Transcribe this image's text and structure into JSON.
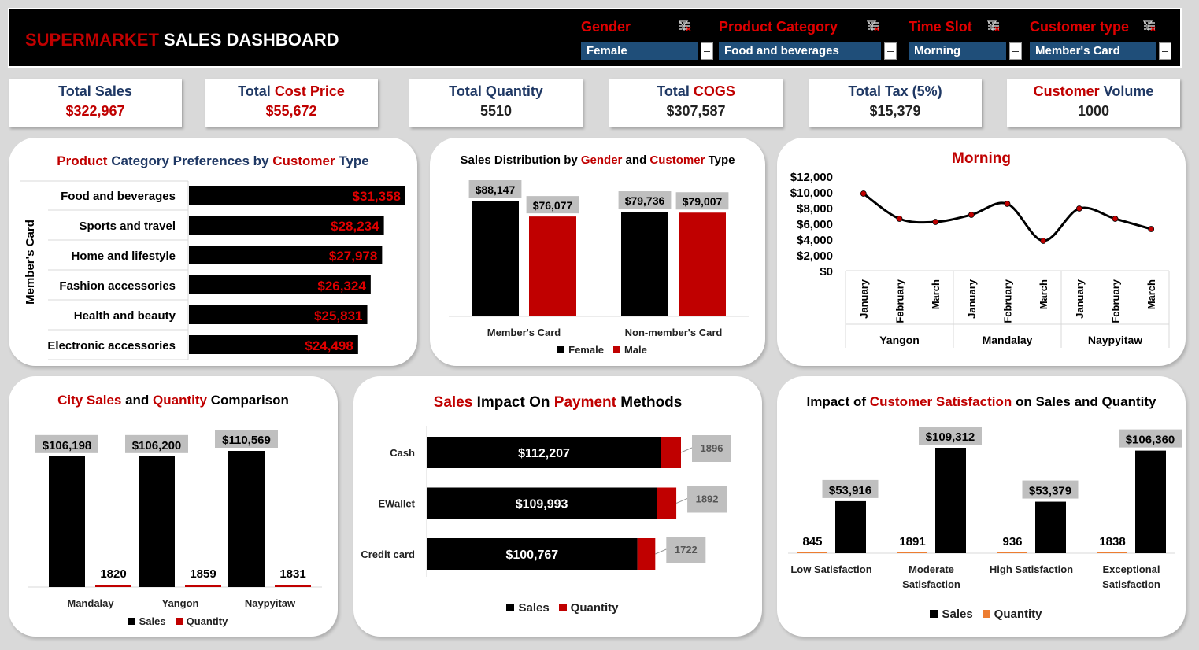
{
  "header": {
    "title_part1": "SUPERMARKET",
    "title_part2": " SALES DASHBOARD",
    "slicers": [
      {
        "title": "Gender",
        "value": "Female"
      },
      {
        "title": "Product Category",
        "value": "Food and beverages"
      },
      {
        "title": "Time Slot",
        "value": "Morning"
      },
      {
        "title": "Customer type",
        "value": "Member's Card"
      }
    ]
  },
  "kpis": {
    "sales": {
      "a": "Total Sales",
      "b": "",
      "value": "$322,967"
    },
    "cost": {
      "a": "Total ",
      "b": "Cost Price",
      "value": "$55,672"
    },
    "qty": {
      "a": "Total Quantity",
      "b": "",
      "value": "5510"
    },
    "cogs": {
      "a": "Total ",
      "b": "COGS",
      "value": "$307,587"
    },
    "tax": {
      "a": "Total Tax (5%)",
      "b": "",
      "value": "$15,379"
    },
    "vol": {
      "a": "Customer",
      "b": " Volume",
      "value": "1000"
    }
  },
  "titles": {
    "p1": [
      "Product",
      " Category Preferences by ",
      "Customer",
      " Type"
    ],
    "p2": [
      "Sales Distribution by ",
      "Gender",
      " and ",
      "Customer",
      " Type"
    ],
    "p4": [
      "City Sales",
      " and ",
      "Quantity",
      " Comparison"
    ],
    "p5": [
      "Sales",
      " Impact On ",
      "Payment",
      " Methods"
    ],
    "p6": [
      "Impact of ",
      "Customer Satisfaction",
      " on Sales and Quantity"
    ]
  },
  "legends": {
    "p2": [
      "Female",
      "Male"
    ],
    "p4": [
      "Sales",
      "Quantity"
    ],
    "p5": [
      "Sales",
      "Quantity"
    ],
    "p6": [
      "Sales",
      "Quantity"
    ]
  },
  "colors": {
    "accent": "#c00000",
    "black": "#000000",
    "gray_label": "#bfbfbf",
    "quantity_orange": "#ed7d31",
    "slicer_blue": "#1f4e79"
  },
  "chart_data": [
    {
      "id": "category-preferences",
      "type": "bar",
      "orientation": "horizontal",
      "group_label": "Member's Card",
      "categories": [
        "Food and beverages",
        "Sports and travel",
        "Home and lifestyle",
        "Fashion accessories",
        "Health and beauty",
        "Electronic accessories"
      ],
      "values": [
        31358,
        28234,
        27978,
        26324,
        25831,
        24498
      ],
      "labels": [
        "$31,358",
        "$28,234",
        "$27,978",
        "$26,324",
        "$25,831",
        "$24,498"
      ]
    },
    {
      "id": "gender-customer",
      "type": "bar",
      "categories": [
        "Member's Card",
        "Non-member's Card"
      ],
      "series": [
        {
          "name": "Female",
          "values": [
            88147,
            79736
          ],
          "labels": [
            "$88,147",
            "$79,736"
          ]
        },
        {
          "name": "Male",
          "values": [
            76077,
            79007
          ],
          "labels": [
            "$76,077",
            "$79,007"
          ]
        }
      ]
    },
    {
      "id": "time-slot-trend",
      "type": "line",
      "title": "Morning",
      "x": [
        "January",
        "February",
        "March",
        "January",
        "February",
        "March",
        "January",
        "February",
        "March"
      ],
      "groups": [
        "Yangon",
        "Mandalay",
        "Naypyitaw"
      ],
      "values": [
        9800,
        6600,
        6200,
        7100,
        8500,
        3800,
        7900,
        6600,
        5300
      ],
      "ylim": [
        0,
        12000
      ],
      "yticks": [
        "$0",
        "$2,000",
        "$4,000",
        "$6,000",
        "$8,000",
        "$10,000",
        "$12,000"
      ]
    },
    {
      "id": "city-comparison",
      "type": "bar",
      "categories": [
        "Mandalay",
        "Yangon",
        "Naypyitaw"
      ],
      "series": [
        {
          "name": "Sales",
          "values": [
            106198,
            106200,
            110569
          ],
          "labels": [
            "$106,198",
            "$106,200",
            "$110,569"
          ]
        },
        {
          "name": "Quantity",
          "values": [
            1820,
            1859,
            1831
          ],
          "labels": [
            "1820",
            "1859",
            "1831"
          ]
        }
      ]
    },
    {
      "id": "payment-methods",
      "type": "bar",
      "orientation": "horizontal",
      "stacked": true,
      "categories": [
        "Cash",
        "EWallet",
        "Credit card"
      ],
      "series": [
        {
          "name": "Sales",
          "values": [
            112207,
            109993,
            100767
          ],
          "labels": [
            "$112,207",
            "$109,993",
            "$100,767"
          ]
        },
        {
          "name": "Quantity",
          "values": [
            1896,
            1892,
            1722
          ],
          "labels": [
            "1896",
            "1892",
            "1722"
          ]
        }
      ]
    },
    {
      "id": "satisfaction-impact",
      "type": "bar",
      "categories": [
        "Low Satisfaction",
        "Moderate Satisfaction",
        "High Satisfaction",
        "Exceptional Satisfaction"
      ],
      "series": [
        {
          "name": "Quantity",
          "values": [
            845,
            1891,
            936,
            1838
          ],
          "labels": [
            "845",
            "1891",
            "936",
            "1838"
          ]
        },
        {
          "name": "Sales",
          "values": [
            53916,
            109312,
            53379,
            106360
          ],
          "labels": [
            "$53,916",
            "$109,312",
            "$53,379",
            "$106,360"
          ]
        }
      ]
    }
  ]
}
